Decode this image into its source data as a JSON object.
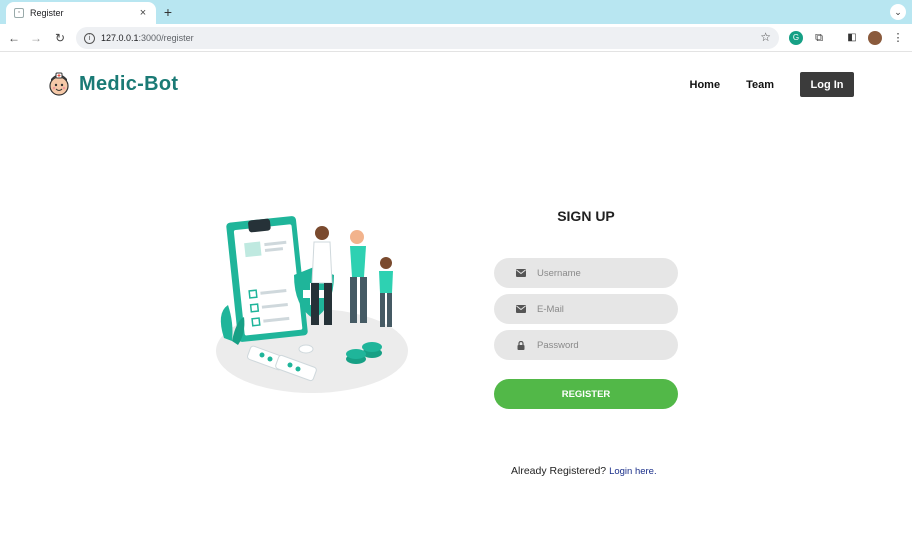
{
  "browser": {
    "tab_title": "Register",
    "tab_close": "×",
    "new_tab": "+",
    "url_host": "127.0.0.1",
    "url_rest": ":3000/register",
    "icons": [
      "back-icon",
      "forward-icon",
      "reload-icon",
      "site-info-icon",
      "bookmark-star-icon",
      "grammarly-icon",
      "extensions-icon",
      "sidepanel-icon",
      "profile-avatar",
      "menu-icon"
    ]
  },
  "header": {
    "brand_name": "Medic-Bot",
    "nav": {
      "home": "Home",
      "team": "Team",
      "login": "Log In"
    }
  },
  "form": {
    "title": "SIGN UP",
    "username_placeholder": "Username",
    "email_placeholder": "E-Mail",
    "password_placeholder": "Password",
    "submit_label": "REGISTER",
    "already_text": "Already Registered?",
    "login_link": "Login here."
  },
  "colors": {
    "brand": "#1a7a75",
    "register_button": "#52b848",
    "login_button": "#3b3b3b",
    "input_bg": "#e6e6e6",
    "tabstrip": "#b8e6f1",
    "illustration_teal": "#1fb59a"
  }
}
